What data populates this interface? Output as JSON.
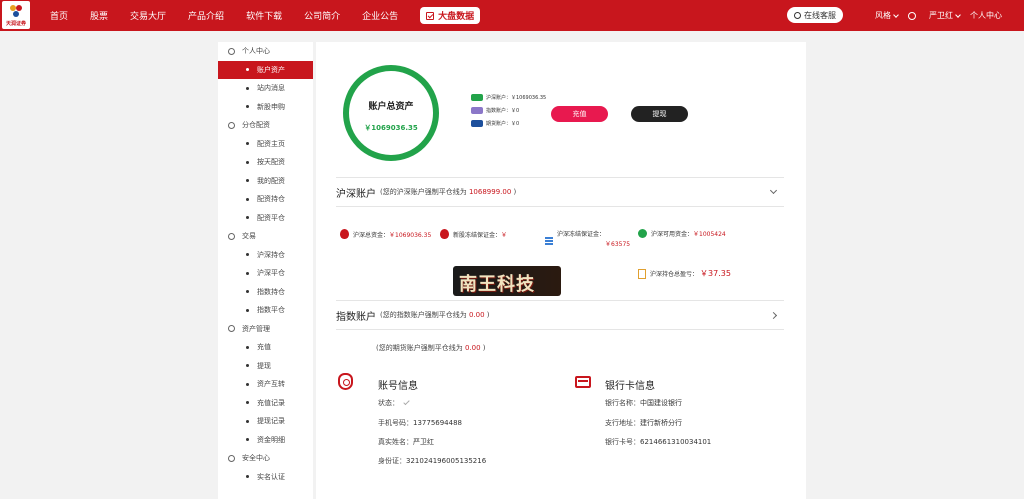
{
  "brand": {
    "logo_text": "天润证券",
    "accent": "#c8161d",
    "green": "#22a34a"
  },
  "nav": {
    "items": [
      "首页",
      "股票",
      "交易大厅",
      "产品介绍",
      "软件下载",
      "公司简介",
      "企业公告"
    ],
    "big_data": "大盘数据",
    "service": "在线客服",
    "style": "风格",
    "user": "严卫红",
    "center": "个人中心"
  },
  "sidebar": {
    "g1": "个人中心",
    "g1_items": [
      "账户资产",
      "站内消息",
      "新股申购"
    ],
    "g2": "分仓配资",
    "g2_items": [
      "配资主页",
      "按天配资",
      "我的配资",
      "配资持仓",
      "配资平仓"
    ],
    "g3": "交易",
    "g3_items": [
      "沪深持仓",
      "沪深平仓",
      "指数持仓",
      "指数平仓"
    ],
    "g4": "资产管理",
    "g4_items": [
      "充值",
      "提现",
      "资产互转",
      "充值记录",
      "提现记录",
      "资金明细"
    ],
    "g5": "安全中心",
    "g5_items": [
      "实名认证"
    ]
  },
  "assets": {
    "title": "账户总资产",
    "total": "￥1069036.35",
    "legend": [
      {
        "label": "沪深账户：￥1069036.35",
        "color": "#22a34a"
      },
      {
        "label": "指数账户：￥0",
        "color": "#8b77c8"
      },
      {
        "label": "期货账户：￥0",
        "color": "#1d4f9c"
      }
    ],
    "recharge": "充值",
    "withdraw": "提现"
  },
  "shsz": {
    "title": "沪深账户",
    "note_prefix": "(您的沪深账户强制平仓线为",
    "note_value": "1068999.00",
    "note_suffix": ")",
    "total_label": "沪深总资金：",
    "total_value": "￥1069036.35",
    "ipo_label": "新股冻结保证金：",
    "ipo_value": "￥",
    "freeze_label": "沪深冻结保证金：",
    "freeze_value": "￥63575",
    "avail_label": "沪深可用资金：",
    "avail_value": "￥1005424",
    "hold_label": "沪深持仓总盈亏：",
    "hold_value": "￥37.35"
  },
  "watermark": "南王科技",
  "index_acc": {
    "title": "指数账户",
    "note_prefix": "(您的指数账户强制平仓线为",
    "note_value": "0.00",
    "note_suffix": ")"
  },
  "futures": {
    "note_prefix": "(您的期货账户强制平仓线为",
    "note_value": "0.00",
    "note_suffix": ")"
  },
  "account_info": {
    "title": "账号信息",
    "status_label": "状态：",
    "phone_label": "手机号码：",
    "phone": "13775694488",
    "name_label": "真实姓名：",
    "name": "严卫红",
    "id_label": "身份证：",
    "id": "321024196005135216"
  },
  "bank_info": {
    "title": "银行卡信息",
    "bank_label": "银行名称：",
    "bank": "中国建设银行",
    "branch_label": "支行地址：",
    "branch": "建行新桥分行",
    "card_label": "银行卡号：",
    "card": "6214661310034101"
  }
}
